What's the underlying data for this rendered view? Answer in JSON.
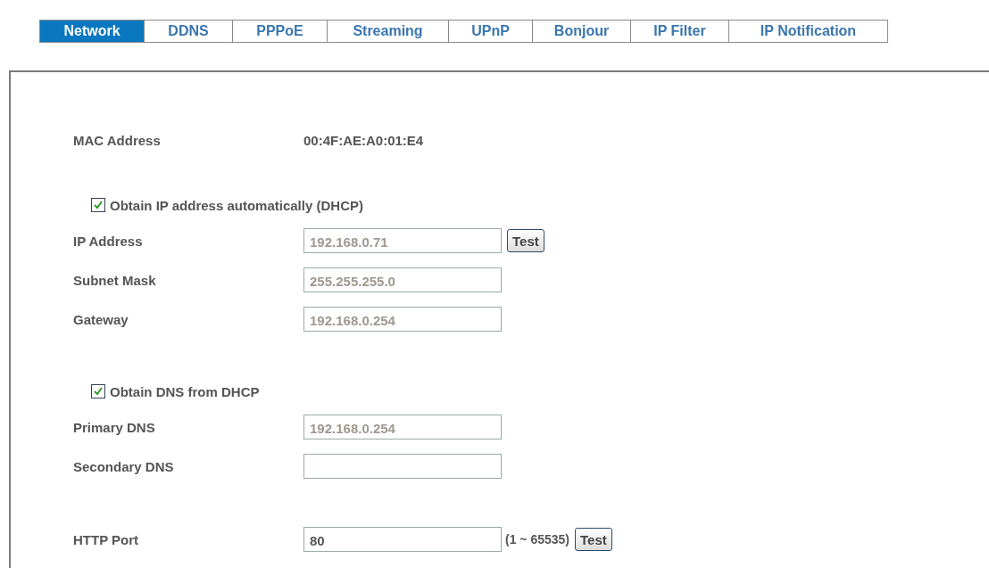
{
  "tabs": [
    {
      "label": "Network",
      "selected": true
    },
    {
      "label": "DDNS",
      "selected": false
    },
    {
      "label": "PPPoE",
      "selected": false
    },
    {
      "label": "Streaming",
      "selected": false
    },
    {
      "label": "UPnP",
      "selected": false
    },
    {
      "label": "Bonjour",
      "selected": false
    },
    {
      "label": "IP Filter",
      "selected": false
    },
    {
      "label": "IP Notification",
      "selected": false
    }
  ],
  "sections": [
    {
      "rows": [
        {
          "kind": "info",
          "label": "MAC Address",
          "value": "00:4F:AE:A0:01:E4"
        }
      ]
    },
    {
      "rows": [
        {
          "kind": "checkbox",
          "label": "Obtain IP address automatically (DHCP)",
          "checked": true
        },
        {
          "kind": "field",
          "label": "IP Address",
          "value": "192.168.0.71",
          "disabled": true,
          "button": "Test"
        },
        {
          "kind": "field",
          "label": "Subnet Mask",
          "value": "255.255.255.0",
          "disabled": true
        },
        {
          "kind": "field",
          "label": "Gateway",
          "value": "192.168.0.254",
          "disabled": true
        }
      ]
    },
    {
      "rows": [
        {
          "kind": "checkbox",
          "label": "Obtain DNS from DHCP",
          "checked": true
        },
        {
          "kind": "field",
          "label": "Primary DNS",
          "value": "192.168.0.254",
          "disabled": true
        },
        {
          "kind": "field",
          "label": "Secondary DNS"
        }
      ]
    },
    {
      "rows": [
        {
          "kind": "field",
          "label": "HTTP Port",
          "value": "80",
          "hint": "(1 ~ 65535)",
          "button": "Test"
        }
      ]
    }
  ]
}
